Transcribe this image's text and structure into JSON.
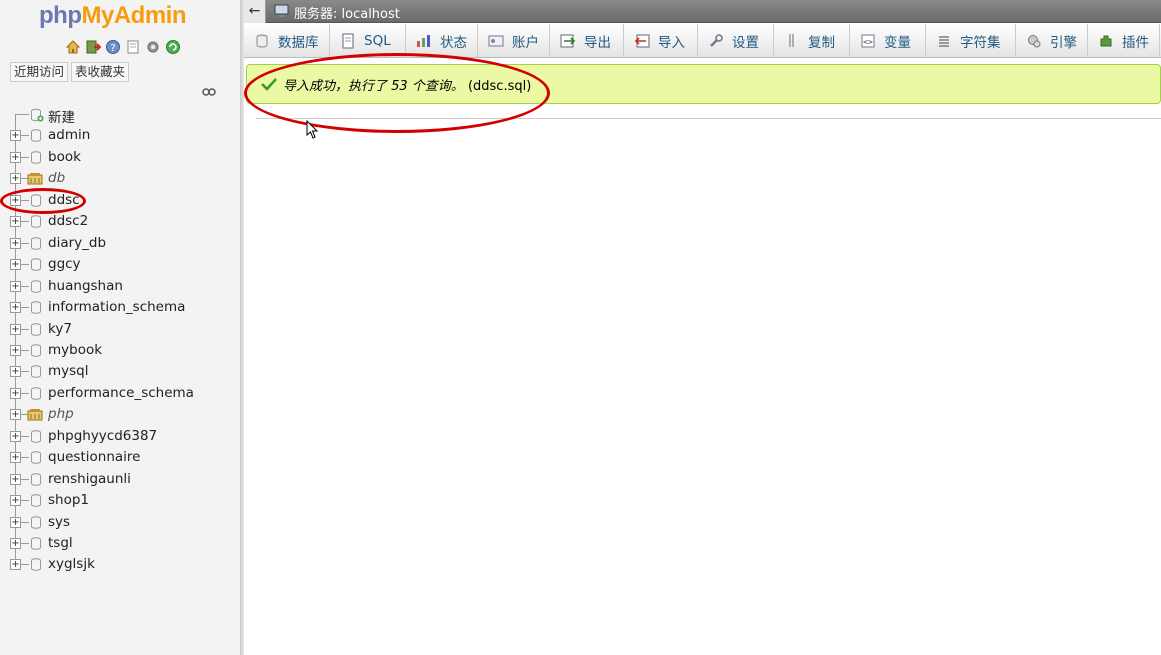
{
  "app": {
    "logo_php": "php",
    "logo_ma": "MyAdmin"
  },
  "nav_icons": [
    "home-icon",
    "exit-icon",
    "help-icon",
    "docs-icon",
    "settings-icon",
    "refresh-icon"
  ],
  "left_tabs": {
    "recent": "近期访问",
    "favorites": "表收藏夹"
  },
  "tree": {
    "new_label": "新建",
    "databases": [
      {
        "name": "admin",
        "italic": false
      },
      {
        "name": "book",
        "italic": false
      },
      {
        "name": "db",
        "italic": true
      },
      {
        "name": "ddsc",
        "italic": false
      },
      {
        "name": "ddsc2",
        "italic": false
      },
      {
        "name": "diary_db",
        "italic": false
      },
      {
        "name": "ggcy",
        "italic": false
      },
      {
        "name": "huangshan",
        "italic": false
      },
      {
        "name": "information_schema",
        "italic": false
      },
      {
        "name": "ky7",
        "italic": false
      },
      {
        "name": "mybook",
        "italic": false
      },
      {
        "name": "mysql",
        "italic": false
      },
      {
        "name": "performance_schema",
        "italic": false
      },
      {
        "name": "php",
        "italic": true
      },
      {
        "name": "phpghyycd6387",
        "italic": false
      },
      {
        "name": "questionnaire",
        "italic": false
      },
      {
        "name": "renshigaunli",
        "italic": false
      },
      {
        "name": "shop1",
        "italic": false
      },
      {
        "name": "sys",
        "italic": false
      },
      {
        "name": "tsgl",
        "italic": false
      },
      {
        "name": "xyglsjk",
        "italic": false
      }
    ]
  },
  "topbar": {
    "back": "←",
    "server_label": "服务器: localhost"
  },
  "menu": [
    {
      "label": "数据库",
      "icon": "database-icon"
    },
    {
      "label": "SQL",
      "icon": "sql-icon"
    },
    {
      "label": "状态",
      "icon": "status-icon"
    },
    {
      "label": "账户",
      "icon": "accounts-icon"
    },
    {
      "label": "导出",
      "icon": "export-icon"
    },
    {
      "label": "导入",
      "icon": "import-icon"
    },
    {
      "label": "设置",
      "icon": "wrench-icon"
    },
    {
      "label": "复制",
      "icon": "replication-icon"
    },
    {
      "label": "变量",
      "icon": "variables-icon"
    },
    {
      "label": "字符集",
      "icon": "charset-icon"
    },
    {
      "label": "引擎",
      "icon": "engine-icon"
    },
    {
      "label": "插件",
      "icon": "plugin-icon"
    }
  ],
  "notice": {
    "message": "导入成功，执行了 53 个查询。",
    "file": "(ddsc.sql)"
  },
  "colors": {
    "annotation": "#d40000",
    "notice_bg": "#ebf8a4",
    "link": "#235a81"
  }
}
